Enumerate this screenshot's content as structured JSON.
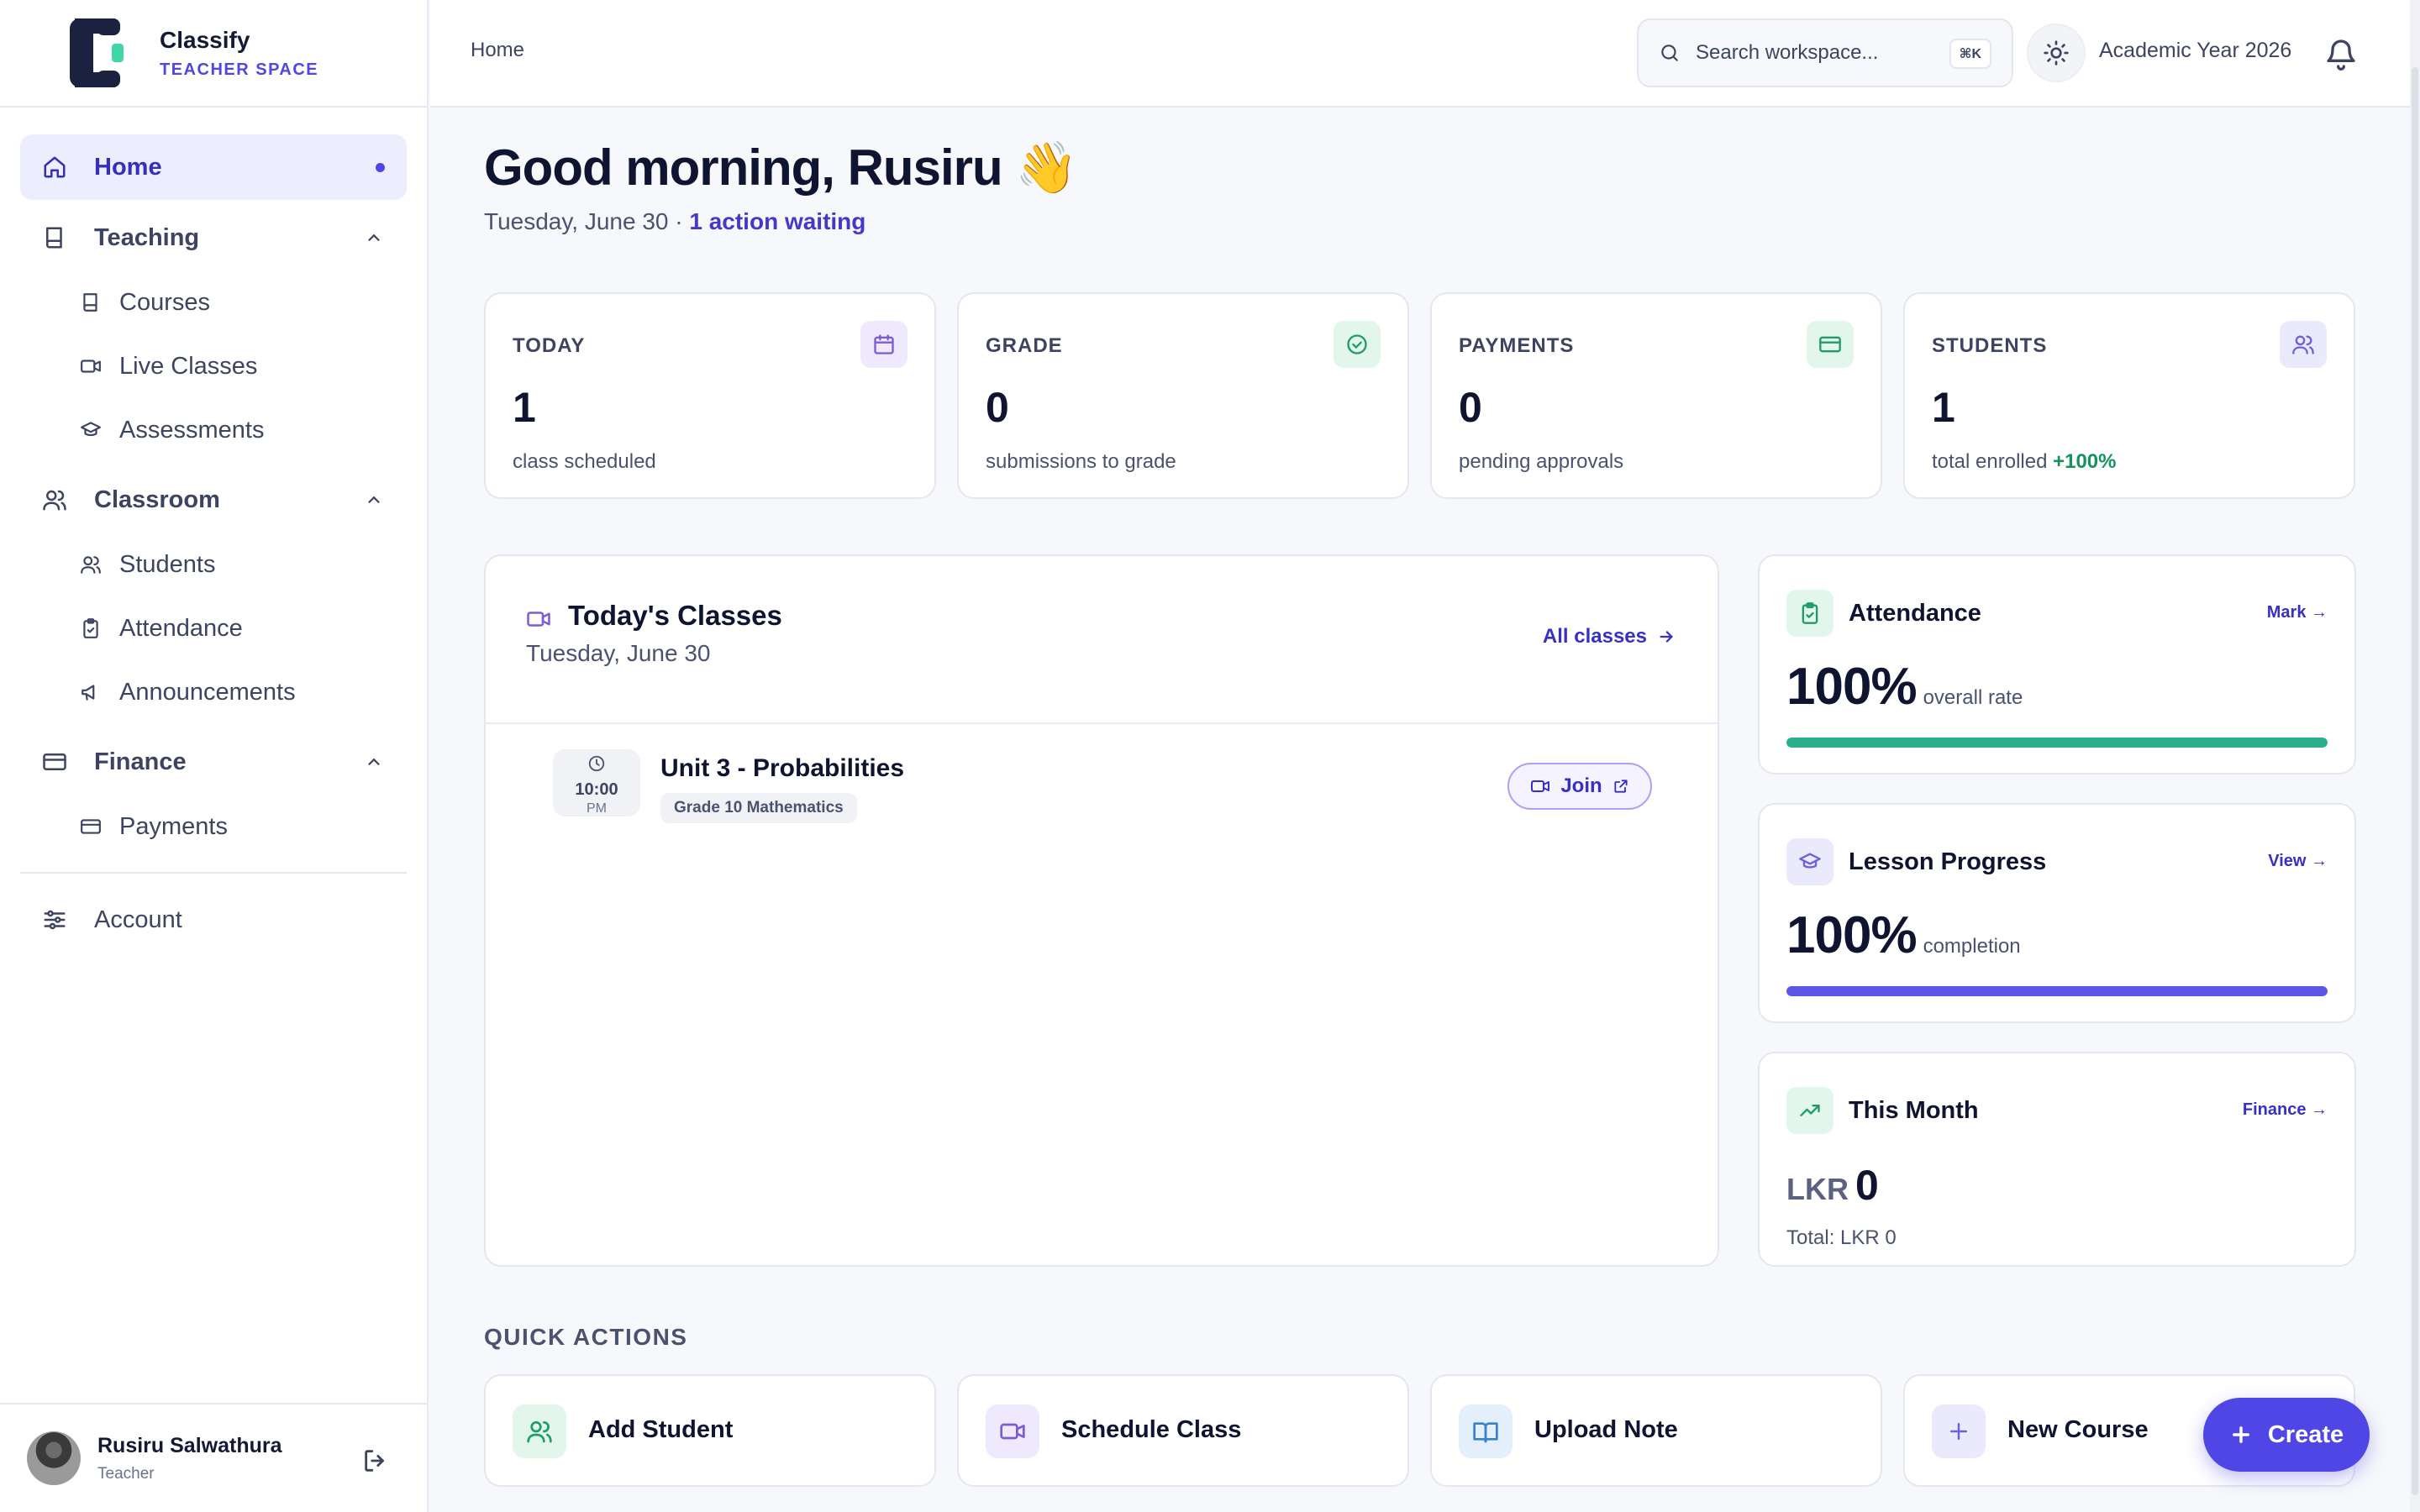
{
  "brand": {
    "name": "Classify",
    "subtitle": "TEACHER SPACE"
  },
  "sidebar": {
    "home": "Home",
    "sections": [
      {
        "label": "Teaching",
        "items": [
          "Courses",
          "Live Classes",
          "Assessments"
        ]
      },
      {
        "label": "Classroom",
        "items": [
          "Students",
          "Attendance",
          "Announcements"
        ]
      },
      {
        "label": "Finance",
        "items": [
          "Payments"
        ]
      }
    ],
    "account": "Account",
    "user": {
      "name": "Rusiru Salwathura",
      "role": "Teacher"
    }
  },
  "topbar": {
    "breadcrumb": "Home",
    "search_placeholder": "Search workspace...",
    "search_shortcut": "⌘K",
    "academic_year": "Academic Year 2026"
  },
  "greeting": {
    "title": "Good morning, Rusiru 👋",
    "date": "Tuesday, June 30 · ",
    "action": "1 action waiting"
  },
  "stats": [
    {
      "label": "TODAY",
      "value": "1",
      "desc": "class scheduled",
      "extra": "",
      "icon": "calendar-icon",
      "color": "#7c5cd6",
      "bg": "#efe9fd"
    },
    {
      "label": "GRADE",
      "value": "0",
      "desc": "submissions to grade",
      "extra": "",
      "icon": "check-circle-icon",
      "color": "#1f9d66",
      "bg": "#e3f6ec"
    },
    {
      "label": "PAYMENTS",
      "value": "0",
      "desc": "pending approvals",
      "extra": "",
      "icon": "card-icon",
      "color": "#1f9d66",
      "bg": "#e3f6ec"
    },
    {
      "label": "STUDENTS",
      "value": "1",
      "desc": "total enrolled ",
      "extra": "+100%",
      "icon": "users-icon",
      "color": "#6d61d9",
      "bg": "#ebe9fc"
    }
  ],
  "todays_classes": {
    "title": "Today's Classes",
    "date": "Tuesday, June 30",
    "all_link": "All classes",
    "items": [
      {
        "time": "10:00",
        "period": "PM",
        "title": "Unit 3 - Probabilities",
        "tag": "Grade 10 Mathematics",
        "action": "Join"
      }
    ]
  },
  "attendance": {
    "title": "Attendance",
    "link": "Mark →",
    "value": "100%",
    "sub": "overall rate",
    "progress": 1.0,
    "color": "#2bb08f"
  },
  "lesson_progress": {
    "title": "Lesson Progress",
    "link": "View →",
    "value": "100%",
    "sub": "completion",
    "progress": 1.0,
    "color": "#5b55e8"
  },
  "this_month": {
    "title": "This Month",
    "link": "Finance →",
    "currency": "LKR",
    "amount": "0",
    "total": "Total: LKR 0"
  },
  "quick_actions": {
    "title": "QUICK ACTIONS",
    "items": [
      {
        "label": "Add Student",
        "icon": "user-plus-icon"
      },
      {
        "label": "Schedule Class",
        "icon": "video-icon"
      },
      {
        "label": "Upload Note",
        "icon": "book-open-icon"
      },
      {
        "label": "New Course",
        "icon": "plus-icon"
      }
    ]
  },
  "fab": {
    "label": "Create"
  }
}
